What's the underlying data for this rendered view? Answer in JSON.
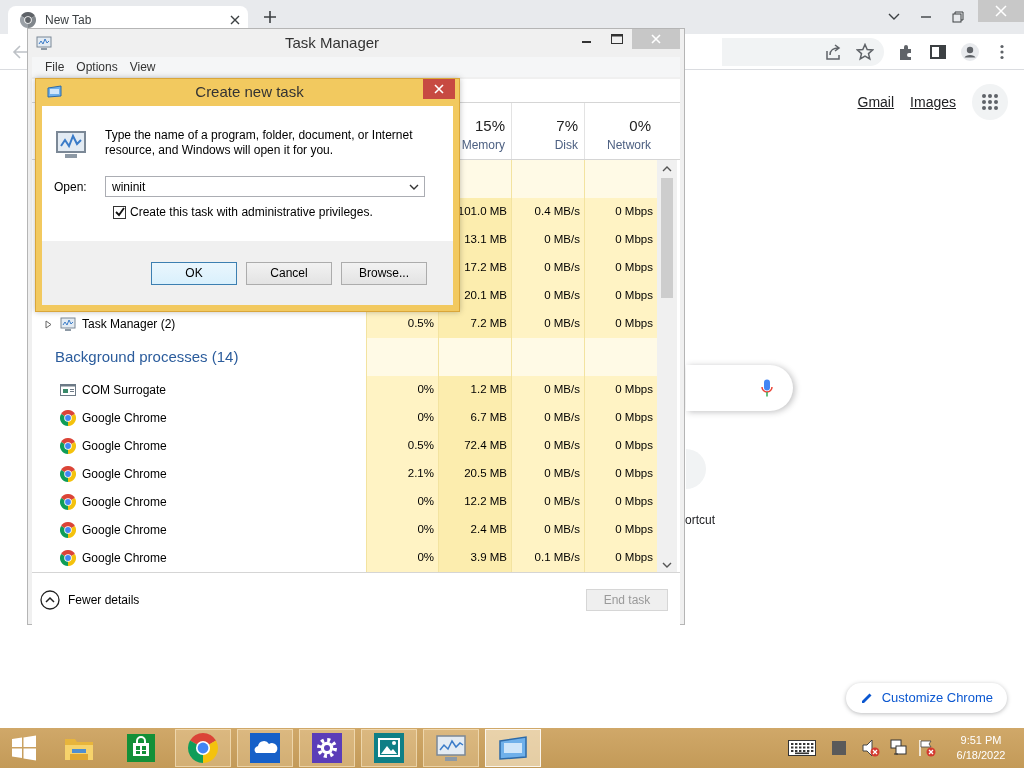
{
  "browser": {
    "tabs": [
      {
        "label": "New Tab",
        "selected": true
      }
    ],
    "links": [
      "Gmail",
      "Images"
    ],
    "shortcut_label": "ortcut",
    "customize_button": "Customize Chrome"
  },
  "task_manager": {
    "title": "Task Manager",
    "menu": [
      "File",
      "Options",
      "View"
    ],
    "columns": [
      {
        "percent": "15%",
        "label": "Memory"
      },
      {
        "percent": "7%",
        "label": "Disk"
      },
      {
        "percent": "0%",
        "label": "Network"
      }
    ],
    "rows": [
      {
        "kind": "group"
      },
      {
        "kind": "row",
        "memory": "101.0 MB",
        "disk": "0.4 MB/s",
        "network": "0 Mbps"
      },
      {
        "kind": "row",
        "memory": "13.1 MB",
        "disk": "0 MB/s",
        "network": "0 Mbps"
      },
      {
        "kind": "row",
        "memory": "17.2 MB",
        "disk": "0 MB/s",
        "network": "0 Mbps"
      },
      {
        "kind": "row",
        "memory": "20.1 MB",
        "disk": "0 MB/s",
        "network": "0 Mbps"
      },
      {
        "kind": "monitor",
        "name": "Task Manager (2)",
        "expanded": false,
        "cpu": "0.5%",
        "memory": "7.2 MB",
        "disk": "0 MB/s",
        "network": "0 Mbps"
      },
      {
        "kind": "group",
        "label": "Background processes (14)"
      },
      {
        "kind": "window",
        "name": "COM Surrogate",
        "cpu": "0%",
        "memory": "1.2 MB",
        "disk": "0 MB/s",
        "network": "0 Mbps"
      },
      {
        "kind": "browser",
        "name": "Google Chrome",
        "cpu": "0%",
        "memory": "6.7 MB",
        "disk": "0 MB/s",
        "network": "0 Mbps"
      },
      {
        "kind": "browser",
        "name": "Google Chrome",
        "cpu": "0.5%",
        "memory": "72.4 MB",
        "disk": "0 MB/s",
        "network": "0 Mbps"
      },
      {
        "kind": "browser",
        "name": "Google Chrome",
        "cpu": "2.1%",
        "memory": "20.5 MB",
        "disk": "0 MB/s",
        "network": "0 Mbps"
      },
      {
        "kind": "browser",
        "name": "Google Chrome",
        "cpu": "0%",
        "memory": "12.2 MB",
        "disk": "0 MB/s",
        "network": "0 Mbps"
      },
      {
        "kind": "browser",
        "name": "Google Chrome",
        "cpu": "0%",
        "memory": "2.4 MB",
        "disk": "0 MB/s",
        "network": "0 Mbps"
      },
      {
        "kind": "browser",
        "name": "Google Chrome",
        "cpu": "0%",
        "memory": "3.9 MB",
        "disk": "0.1 MB/s",
        "network": "0 Mbps"
      }
    ],
    "fewer_details": "Fewer details",
    "end_task": {
      "label": "End task",
      "disabled": true
    }
  },
  "dialog": {
    "title": "Create new task",
    "message": "Type the name of a program, folder, document, or Internet resource, and Windows will open it for you.",
    "open_label": "Open:",
    "open_value": "wininit",
    "admin_checkbox": {
      "label": "Create this task with administrative privileges.",
      "checked": true
    },
    "buttons": [
      {
        "label": "OK",
        "default": true
      },
      {
        "label": "Cancel",
        "default": false
      },
      {
        "label": "Browse...",
        "default": false
      }
    ]
  },
  "taskbar": {
    "apps": [
      {
        "kind": "start"
      },
      {
        "kind": "folder",
        "running": false,
        "selected": false
      },
      {
        "kind": "store",
        "running": false,
        "selected": false
      },
      {
        "kind": "chrome",
        "running": true,
        "selected": false
      },
      {
        "kind": "cloud",
        "running": true,
        "selected": false
      },
      {
        "kind": "gear",
        "running": true,
        "selected": false
      },
      {
        "kind": "photo",
        "running": true,
        "selected": false
      },
      {
        "kind": "monitor",
        "running": true,
        "selected": false
      },
      {
        "kind": "dialog",
        "running": true,
        "selected": true
      }
    ],
    "clock": {
      "time": "9:51 PM",
      "date": "6/18/2022"
    }
  }
}
